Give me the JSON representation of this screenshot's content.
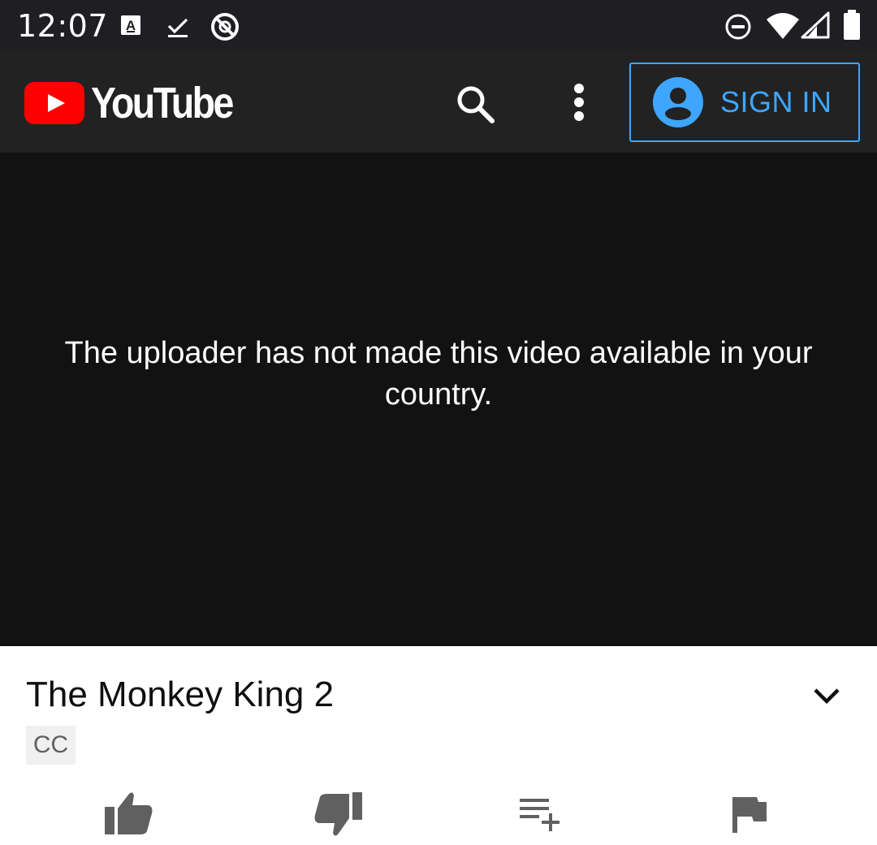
{
  "status_bar": {
    "time": "12:07",
    "icons": [
      "font-a-icon",
      "download-done-icon",
      "data-saver-icon",
      "do-not-disturb-icon",
      "wifi-icon",
      "cell-signal-icon",
      "battery-icon"
    ]
  },
  "header": {
    "logo_text": "YouTube",
    "sign_in_label": "SIGN IN",
    "accent_color": "#3ea6ff",
    "brand_red": "#ff0000"
  },
  "player": {
    "message": "The uploader has not made this video available in your country."
  },
  "video": {
    "title": "The Monkey King 2",
    "badge": "CC"
  },
  "actions": [
    "like-icon",
    "dislike-icon",
    "add-to-playlist-icon",
    "report-flag-icon"
  ]
}
